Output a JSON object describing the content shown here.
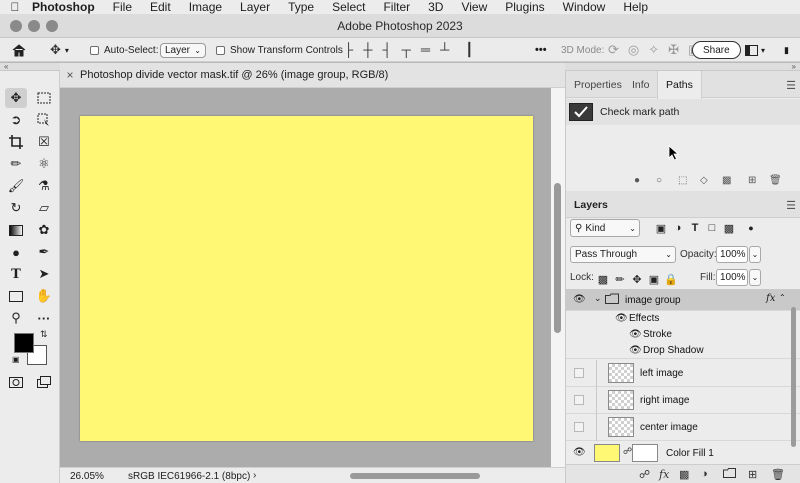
{
  "menubar": {
    "app": "Photoshop",
    "items": [
      "File",
      "Edit",
      "Image",
      "Layer",
      "Type",
      "Select",
      "Filter",
      "3D",
      "View",
      "Plugins",
      "Window",
      "Help"
    ]
  },
  "window": {
    "title": "Adobe Photoshop 2023"
  },
  "options": {
    "auto_select_label": "Auto-Select:",
    "auto_select_value": "Layer",
    "show_transform_label": "Show Transform Controls",
    "three_d_mode_label": "3D Mode:",
    "share_label": "Share",
    "more_label": "•••"
  },
  "document": {
    "tab_title": "Photoshop divide vector mask.tif @ 26% (image group, RGB/8)",
    "canvas_color": "#fef874"
  },
  "status": {
    "zoom": "26.05%",
    "profile": "sRGB IEC61966-2.1 (8bpc)",
    "arrow": "›"
  },
  "paths_panel": {
    "tabs": [
      "Properties",
      "Info",
      "Paths"
    ],
    "active_tab": "Paths",
    "paths": [
      {
        "name": "Check mark path"
      }
    ]
  },
  "layers_panel": {
    "title": "Layers",
    "kind_label": "Kind",
    "blend_mode": "Pass Through",
    "opacity_label": "Opacity:",
    "opacity_value": "100%",
    "lock_label": "Lock:",
    "fill_label": "Fill:",
    "fill_value": "100%",
    "layers": [
      {
        "name": "image group",
        "type": "group",
        "visible": true,
        "fx": "fx"
      },
      {
        "name": "Effects",
        "type": "effects",
        "visible": true
      },
      {
        "name": "Stroke",
        "type": "effect",
        "visible": true
      },
      {
        "name": "Drop Shadow",
        "type": "effect",
        "visible": true
      },
      {
        "name": "left image",
        "type": "smart",
        "visible": false
      },
      {
        "name": "right image",
        "type": "smart",
        "visible": false
      },
      {
        "name": "center image",
        "type": "smart",
        "visible": false
      },
      {
        "name": "Color Fill 1",
        "type": "fill",
        "visible": true,
        "color": "#fef874"
      }
    ],
    "footer_fx": "fx"
  },
  "colors": {
    "foreground": "#000000",
    "background": "#ffffff",
    "accent": "#2a2a2a"
  }
}
